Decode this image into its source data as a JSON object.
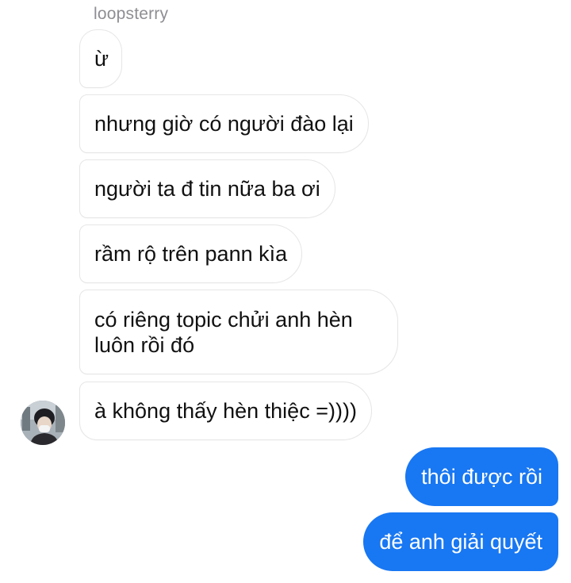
{
  "conversation": {
    "sender_name": "loopsterry",
    "incoming": [
      {
        "text": "ừ"
      },
      {
        "text": "nhưng giờ có người đào lại"
      },
      {
        "text": "người ta đ tin nữa ba ơi"
      },
      {
        "text": "rầm rộ trên pann kìa"
      },
      {
        "text": "có riêng topic chửi anh hèn luôn rồi đó"
      },
      {
        "text": "à không thấy hèn thiệc =))))"
      }
    ],
    "outgoing": [
      {
        "text": "thôi được rồi"
      },
      {
        "text": "để anh giải quyết"
      }
    ]
  },
  "colors": {
    "outgoing_bubble": "#1877f2",
    "incoming_bubble": "#ffffff",
    "incoming_border": "#e6e6e6",
    "sender_name": "#8e8e93"
  },
  "icons": {
    "avatar": "profile-photo"
  }
}
